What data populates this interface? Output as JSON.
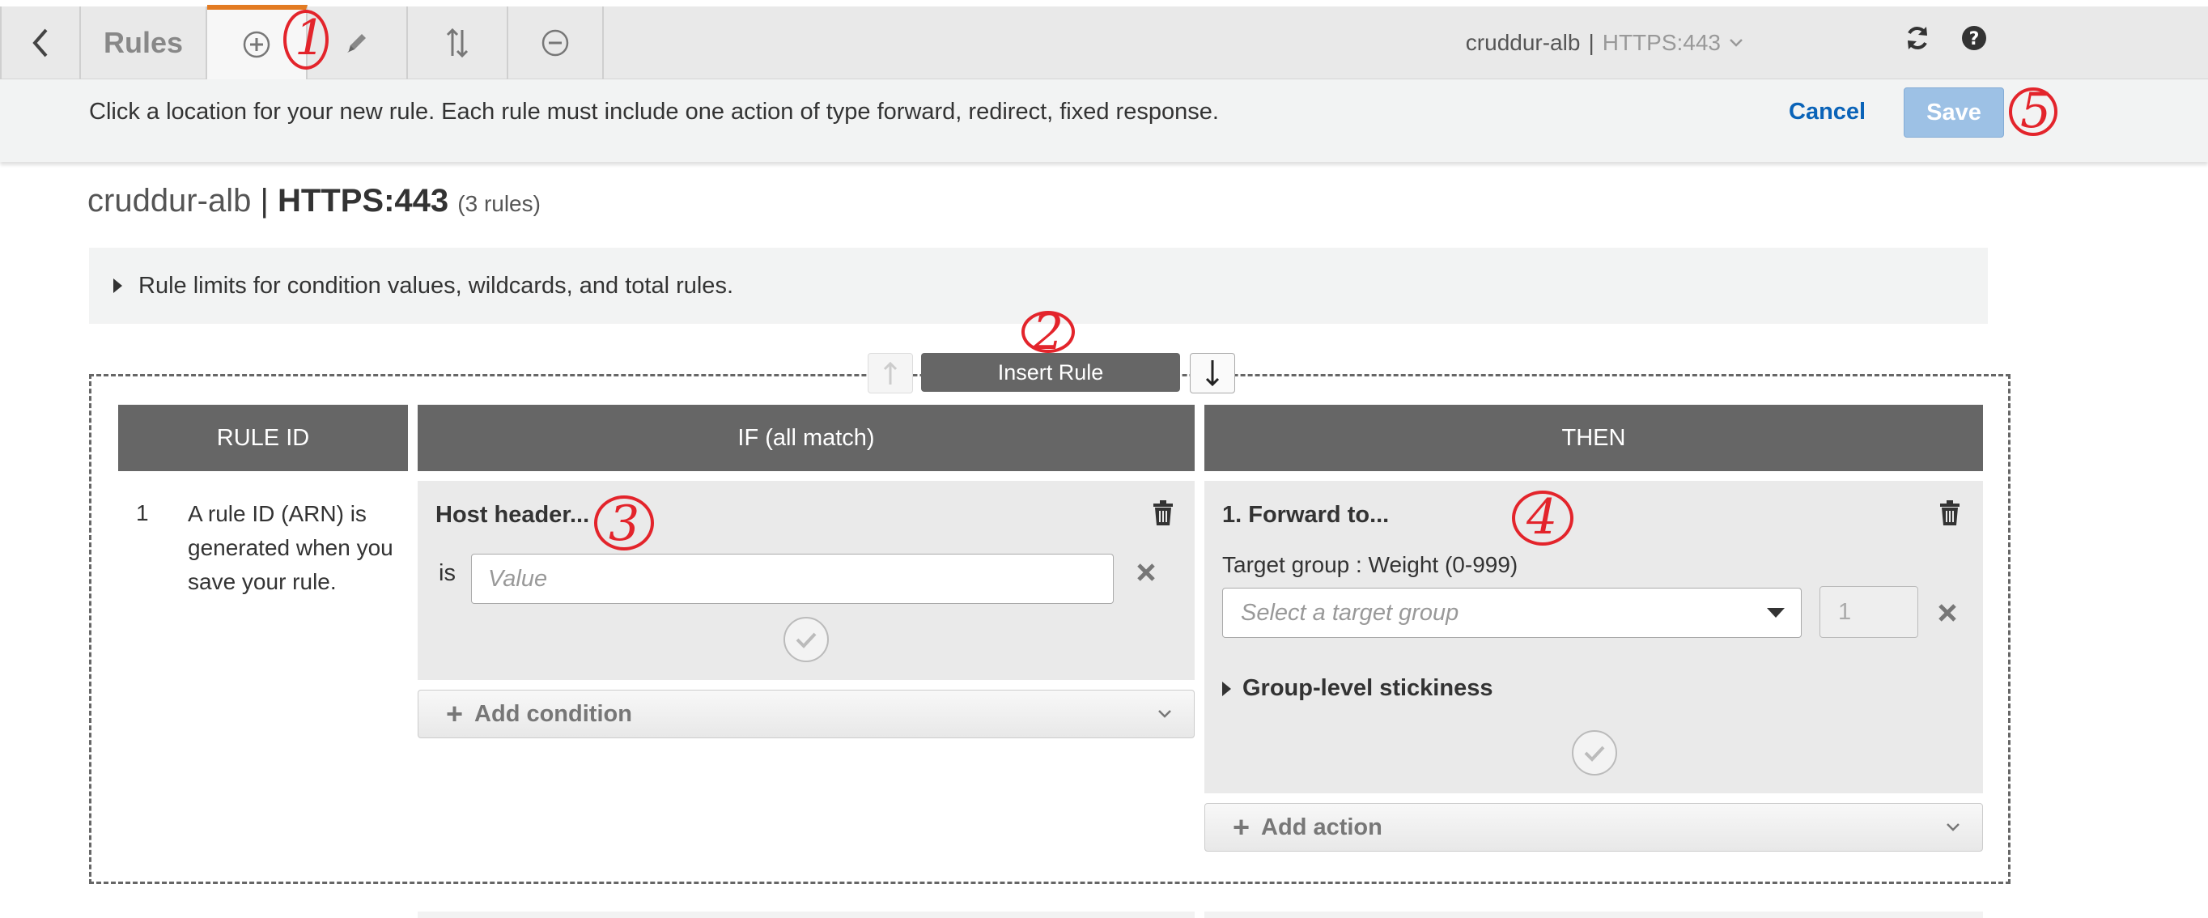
{
  "toolbar": {
    "rules_label": "Rules",
    "listener_lb": "cruddur-alb",
    "listener_sep": "|",
    "listener_port": "HTTPS:443"
  },
  "info": {
    "text": "Click a location for your new rule. Each rule must include one action of type forward, redirect, fixed response.",
    "cancel_label": "Cancel",
    "save_label": "Save"
  },
  "heading": {
    "lb_name": "cruddur-alb",
    "sep": "|",
    "port": "HTTPS:443",
    "rule_count": "(3 rules)"
  },
  "limits_text": "Rule limits for condition values, wildcards, and total rules.",
  "insert_rule_label": "Insert Rule",
  "columns": {
    "rule_id": "RULE ID",
    "if": "IF (all match)",
    "then": "THEN"
  },
  "rule": {
    "number": "1",
    "description": "A rule ID (ARN) is generated when you save your rule."
  },
  "condition": {
    "title": "Host header...",
    "operator": "is",
    "value_placeholder": "Value",
    "add_label": "Add condition"
  },
  "action": {
    "title": "1. Forward to...",
    "target_label": "Target group : Weight (0-999)",
    "target_placeholder": "Select a target group",
    "weight": "1",
    "stickiness_label": "Group-level stickiness",
    "add_label": "Add action"
  },
  "annotations": [
    "1",
    "2",
    "3",
    "4",
    "5"
  ],
  "colors": {
    "accent": "#e37b22",
    "link": "#0a63b8",
    "save_disabled": "#9dc1e5",
    "header_bg": "#666666",
    "annotation": "#e3242b"
  }
}
